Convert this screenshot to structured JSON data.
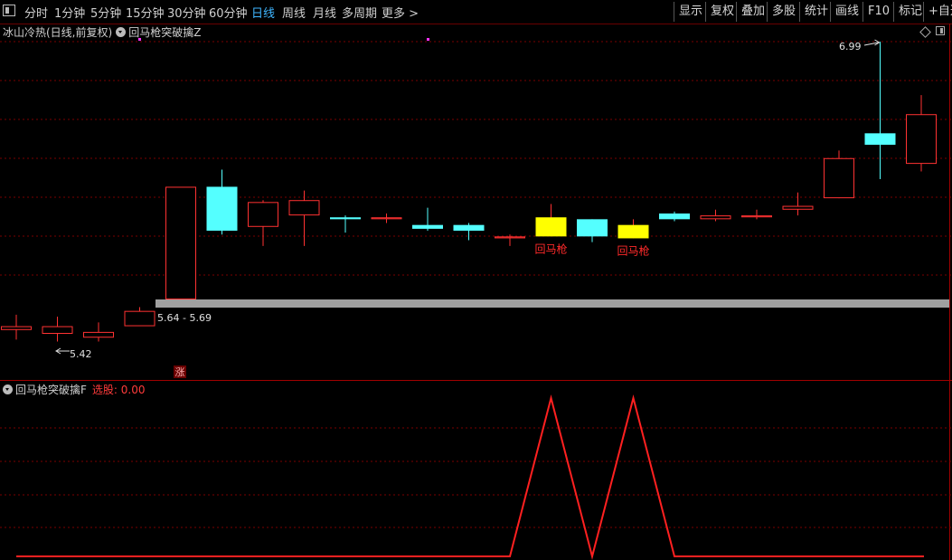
{
  "toolbar": {
    "periods": [
      {
        "label": "分时",
        "active": false
      },
      {
        "label": "1分钟",
        "active": false
      },
      {
        "label": "5分钟",
        "active": false
      },
      {
        "label": "15分钟",
        "active": false
      },
      {
        "label": "30分钟",
        "active": false
      },
      {
        "label": "60分钟",
        "active": false
      },
      {
        "label": "日线",
        "active": true
      },
      {
        "label": "周线",
        "active": false
      },
      {
        "label": "月线",
        "active": false
      },
      {
        "label": "多周期",
        "active": false
      },
      {
        "label": "更多 >",
        "active": false
      }
    ],
    "right_buttons": [
      "显示",
      "复权",
      "叠加",
      "多股",
      "统计",
      "画线",
      "F10",
      "标记",
      "+自选"
    ]
  },
  "main_header": {
    "stock": "冰山冷热(日线,前复权)",
    "indicator": "回马枪突破擒Z"
  },
  "sub_header": {
    "indicator": "回马枪突破擒F",
    "xuangu_label": "选股: 0.00"
  },
  "colors": {
    "up": "#ff3232",
    "down": "#54ffff",
    "signal": "#ffff00",
    "grid": "#7a0000",
    "band": "#a0a0a0",
    "signal_line": "#ff2020"
  },
  "chart_data": {
    "type": "candlestick",
    "price_ylim": [
      5.3,
      7.05
    ],
    "candles": [
      {
        "open": 5.48,
        "close": 5.5,
        "high": 5.56,
        "low": 5.43,
        "kind": "up"
      },
      {
        "open": 5.46,
        "close": 5.5,
        "high": 5.55,
        "low": 5.42,
        "kind": "up"
      },
      {
        "open": 5.44,
        "close": 5.47,
        "high": 5.52,
        "low": 5.42,
        "kind": "up"
      },
      {
        "open": 5.5,
        "close": 5.58,
        "high": 5.6,
        "low": 5.5,
        "kind": "up"
      },
      {
        "open": 5.64,
        "close": 6.23,
        "high": 6.23,
        "low": 5.64,
        "kind": "up"
      },
      {
        "open": 6.23,
        "close": 6.0,
        "high": 6.32,
        "low": 5.98,
        "kind": "down"
      },
      {
        "open": 6.02,
        "close": 6.15,
        "high": 6.16,
        "low": 5.92,
        "kind": "up"
      },
      {
        "open": 6.08,
        "close": 6.16,
        "high": 6.21,
        "low": 5.92,
        "kind": "up"
      },
      {
        "open": 6.07,
        "close": 6.06,
        "high": 6.08,
        "low": 5.99,
        "kind": "down"
      },
      {
        "open": 6.06,
        "close": 6.07,
        "high": 6.09,
        "low": 6.04,
        "kind": "up"
      },
      {
        "open": 6.03,
        "close": 6.01,
        "high": 6.12,
        "low": 6.0,
        "kind": "down"
      },
      {
        "open": 6.03,
        "close": 6.0,
        "high": 6.04,
        "low": 5.95,
        "kind": "down"
      },
      {
        "open": 5.96,
        "close": 5.97,
        "high": 5.98,
        "low": 5.92,
        "kind": "up"
      },
      {
        "open": 6.07,
        "close": 5.97,
        "high": 6.14,
        "low": 5.97,
        "kind": "signal"
      },
      {
        "open": 6.06,
        "close": 5.97,
        "high": 6.06,
        "low": 5.94,
        "kind": "down"
      },
      {
        "open": 6.03,
        "close": 5.96,
        "high": 6.06,
        "low": 5.96,
        "kind": "signal"
      },
      {
        "open": 6.09,
        "close": 6.06,
        "high": 6.1,
        "low": 6.05,
        "kind": "down"
      },
      {
        "open": 6.06,
        "close": 6.08,
        "high": 6.11,
        "low": 6.05,
        "kind": "up"
      },
      {
        "open": 6.07,
        "close": 6.08,
        "high": 6.11,
        "low": 6.06,
        "kind": "up"
      },
      {
        "open": 6.11,
        "close": 6.13,
        "high": 6.2,
        "low": 6.08,
        "kind": "up"
      },
      {
        "open": 6.17,
        "close": 6.38,
        "high": 6.42,
        "low": 6.17,
        "kind": "up"
      },
      {
        "open": 6.51,
        "close": 6.45,
        "high": 6.99,
        "low": 6.27,
        "kind": "down"
      },
      {
        "open": 6.35,
        "close": 6.61,
        "high": 6.71,
        "low": 6.31,
        "kind": "up"
      }
    ],
    "band_range": [
      5.64,
      5.69
    ],
    "annotations": {
      "high_label": "6.99",
      "low_label": "5.42",
      "range_label": "5.64 - 5.69",
      "signal_text": "回马枪",
      "zhang_text": "涨"
    },
    "signal_series": [
      0,
      0,
      0,
      0,
      0,
      0,
      0,
      0,
      0,
      0,
      0,
      0,
      0,
      1,
      0,
      1,
      0,
      0,
      0,
      0,
      0,
      0,
      0
    ]
  }
}
